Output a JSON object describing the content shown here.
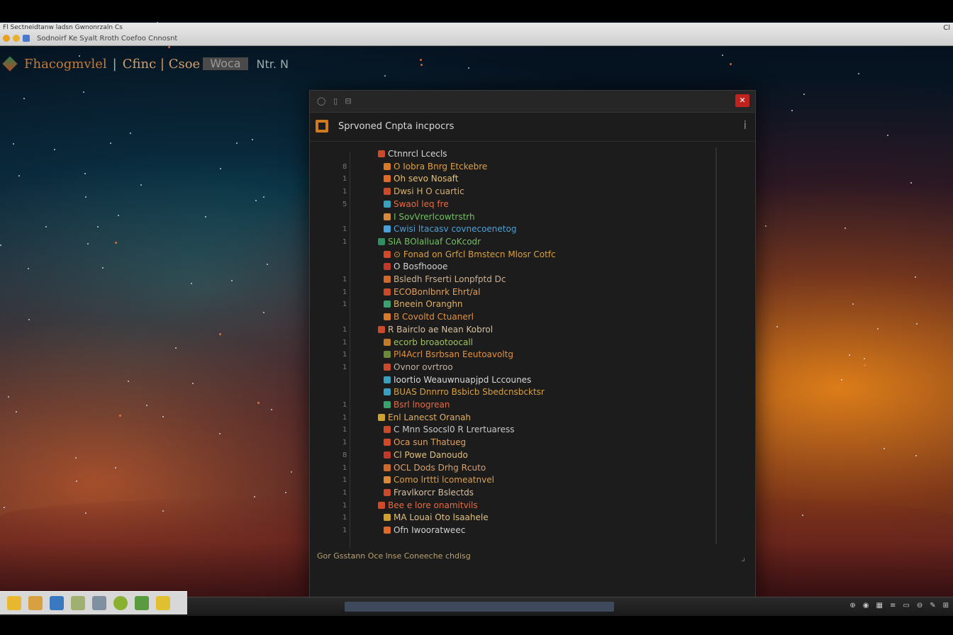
{
  "browser": {
    "menu_text": "Fl  Sectneidtanw ladsn  Gwnonrzaln Cs",
    "address": "Sodnoirf   Ke  Syalt Rroth Coefoo Cnnosnt",
    "right_text": "Cl"
  },
  "page_header": {
    "title": "Fhacogmvlel",
    "separator": "|",
    "subtitle": "Cfinc | Csoe",
    "box_text": "Woca",
    "tail": "Ntr. N"
  },
  "window": {
    "titlebar_buttons": [
      "◯",
      "▯",
      "⊟"
    ],
    "close_icon": "✕",
    "title": "Sprvoned Cnpta incpocrs",
    "info_icon": "i",
    "items": [
      {
        "num": "",
        "text": "Ctnnrcl Lcecls",
        "color": "#d6d6d6",
        "icon": "#c94b2c"
      },
      {
        "num": "8",
        "text": "O Iobra Bnrg Etckebre",
        "color": "#e0a040",
        "icon": "#d87a2a"
      },
      {
        "num": "1",
        "text": "Oh  sevo Nosaft",
        "color": "#e8c070",
        "icon": "#e06a2a"
      },
      {
        "num": "1",
        "text": "Dwsi  H O cuartic",
        "color": "#d8b070",
        "icon": "#c94b2c"
      },
      {
        "num": "5",
        "text": "Swaol leq fre",
        "color": "#e86a40",
        "icon": "#3aa0c0"
      },
      {
        "num": "",
        "text": "I  SovVrerlcowtrstrh",
        "color": "#70c060",
        "icon": "#d88a3a"
      },
      {
        "num": "1",
        "text": "Cwisi ltacasv covnecoenetog",
        "color": "#4aa0d8",
        "icon": "#4aa0d8"
      },
      {
        "num": "1",
        "text": "SIA  BOlalluaf CoKcodr",
        "color": "#70c060",
        "icon": "#2f8f60"
      },
      {
        "num": "",
        "text": "⊙ Fonad  on Grfcl  Bmstecn  Mlosr Cotfc",
        "color": "#d8a040",
        "icon": "#d04a2a"
      },
      {
        "num": "",
        "text": "O Bosfhoooe",
        "color": "#d0d0d0",
        "icon": "#c03a2a"
      },
      {
        "num": "1",
        "text": "Bsledh Frserti Lonpfptd Dc",
        "color": "#d0b090",
        "icon": "#d06a2a"
      },
      {
        "num": "1",
        "text": "ECOBonlbnrk Ehrt/al",
        "color": "#e0a060",
        "icon": "#c94b2c"
      },
      {
        "num": "1",
        "text": "Bneein Oranghn",
        "color": "#e0b060",
        "icon": "#3aa070"
      },
      {
        "num": "",
        "text": "B Covoltd Ctuanerl",
        "color": "#e09040",
        "icon": "#d87a2a"
      },
      {
        "num": "1",
        "text": "R Bairclo ae Nean Kobrol",
        "color": "#d8c0a0",
        "icon": "#c94b2c"
      },
      {
        "num": "1",
        "text": "ecorb  broaotoocall",
        "color": "#a0c060",
        "icon": "#c07a2a"
      },
      {
        "num": "1",
        "text": "Pl4Acrl  Bsrbsan Eeutoavoltg",
        "color": "#e09040",
        "icon": "#6a8a3a"
      },
      {
        "num": "1",
        "text": "Ovnor ovrtroo",
        "color": "#c0b0a0",
        "icon": "#c94b2c"
      },
      {
        "num": "",
        "text": "Ioortio Weauwnuapjpd Lccounes",
        "color": "#d8d8d8",
        "icon": "#3aa0c0"
      },
      {
        "num": "",
        "text": "BUAS Dnnrro  Bsbicb  Sbedcnsbcktsr",
        "color": "#d8a040",
        "icon": "#3aa0c0"
      },
      {
        "num": "1",
        "text": "Bsrl  lnogrean",
        "color": "#e86a40",
        "icon": "#3aa070"
      },
      {
        "num": "1",
        "text": "Enl  Lanecst Oranah",
        "color": "#e0b060",
        "icon": "#d0a030"
      },
      {
        "num": "1",
        "text": "C  Mnn Ssocsl0 R Lrertuaress",
        "color": "#c8c8c8",
        "icon": "#c94b2c"
      },
      {
        "num": "1",
        "text": "Oca    sun Thatueg",
        "color": "#e0a060",
        "icon": "#d04a2a"
      },
      {
        "num": "8",
        "text": "Cl    Powe Danoudo",
        "color": "#e0c080",
        "icon": "#c03a2a"
      },
      {
        "num": "1",
        "text": "OCL Dods Drhg Rcuto",
        "color": "#d8a070",
        "icon": "#d06a2a"
      },
      {
        "num": "1",
        "text": "Como lrttti lcomeatnvel",
        "color": "#d8a050",
        "icon": "#d88a3a"
      },
      {
        "num": "1",
        "text": "Fravlkorcr Bslectds",
        "color": "#d8c0a0",
        "icon": "#c94b2c"
      },
      {
        "num": "1",
        "text": "Bee  e lore onamitvils",
        "color": "#e86a40",
        "icon": "#d04a2a"
      },
      {
        "num": "1",
        "text": "MA  Louai Oto lsaahele",
        "color": "#e0c080",
        "icon": "#d0a030"
      },
      {
        "num": "1",
        "text": "Ofn  Iwooratweec",
        "color": "#d0d0d0",
        "icon": "#e06a2a"
      }
    ],
    "footer": "Gor  Gsstann  Oce  lnse Coneeche chdisg",
    "corner": "⌟"
  },
  "taskbar": {
    "tray_items": [
      "⊕",
      "◉",
      "▦",
      "≡",
      "▭",
      "⊖",
      "✎",
      "⊞"
    ]
  }
}
